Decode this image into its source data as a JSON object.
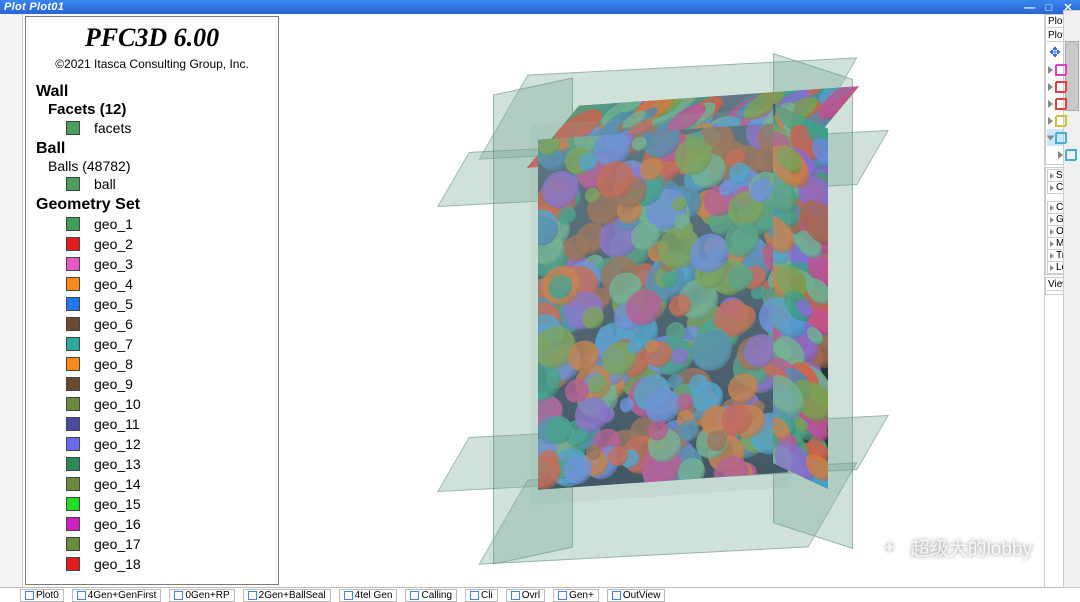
{
  "titlebar": {
    "title": "Plot Plot01"
  },
  "legend": {
    "product": "PFC3D 6.00",
    "copyright": "©2021 Itasca Consulting Group, Inc.",
    "wall": {
      "heading": "Wall",
      "facets_label": "Facets (12)",
      "facets_item": "facets",
      "facets_color": "#4d9e5d"
    },
    "ball": {
      "heading": "Ball",
      "balls_label": "Balls (48782)",
      "ball_item": "ball",
      "ball_color": "#4d9e5d"
    },
    "geom": {
      "heading": "Geometry Set",
      "items": [
        {
          "label": "geo_1",
          "color": "#3c9e56"
        },
        {
          "label": "geo_2",
          "color": "#e41a1c"
        },
        {
          "label": "geo_3",
          "color": "#e858c8"
        },
        {
          "label": "geo_4",
          "color": "#ff8a1a"
        },
        {
          "label": "geo_5",
          "color": "#1f78ef"
        },
        {
          "label": "geo_6",
          "color": "#6d4a2f"
        },
        {
          "label": "geo_7",
          "color": "#2aa8a0"
        },
        {
          "label": "geo_8",
          "color": "#ff8a1a"
        },
        {
          "label": "geo_9",
          "color": "#6d4a2f"
        },
        {
          "label": "geo_10",
          "color": "#6a8a3c"
        },
        {
          "label": "geo_11",
          "color": "#4a4aa0"
        },
        {
          "label": "geo_12",
          "color": "#6a6aef"
        },
        {
          "label": "geo_13",
          "color": "#2a8a5a"
        },
        {
          "label": "geo_14",
          "color": "#6a8a3c"
        },
        {
          "label": "geo_15",
          "color": "#20e020"
        },
        {
          "label": "geo_16",
          "color": "#d020c0"
        },
        {
          "label": "geo_17",
          "color": "#6a8a3c"
        },
        {
          "label": "geo_18",
          "color": "#e41a1c"
        }
      ]
    }
  },
  "right_panel": {
    "top_label": "Plot",
    "plot_label": "Plot",
    "properties": [
      {
        "label": "Sha"
      },
      {
        "label": "Col"
      },
      {
        "label": "Col"
      },
      {
        "label": "Gho"
      },
      {
        "label": "Ori"
      },
      {
        "label": "Map"
      },
      {
        "label": "Tra"
      },
      {
        "label": "Leg"
      }
    ],
    "view_label": "View"
  },
  "watermark": {
    "text": "超级大的lobby"
  },
  "bottom_tabs": [
    {
      "label": "Plot0"
    },
    {
      "label": "4Gen+GenFirst"
    },
    {
      "label": "0Gen+RP"
    },
    {
      "label": "2Gen+BallSeal"
    },
    {
      "label": "4tel Gen"
    },
    {
      "label": "Calling"
    },
    {
      "label": "Cli"
    },
    {
      "label": "Ovrl"
    },
    {
      "label": "Gen+"
    },
    {
      "label": "OutView"
    }
  ]
}
